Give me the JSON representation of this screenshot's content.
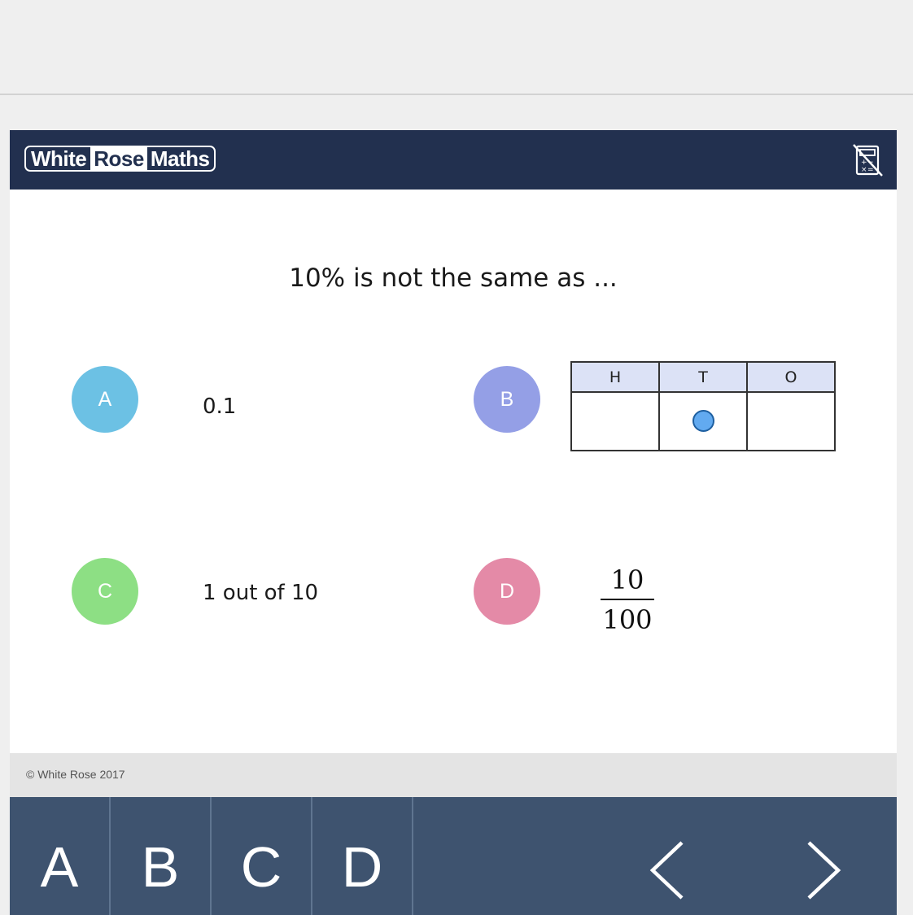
{
  "header": {
    "logo": {
      "word1": "White",
      "word2": "Rose",
      "word3": "Maths"
    },
    "calculator_icon": "calculator-disabled-icon"
  },
  "question": {
    "text": "10% is not the same as ..."
  },
  "options": {
    "a": {
      "letter": "A",
      "text": "0.1",
      "color": "#6cc1e4"
    },
    "b": {
      "letter": "B",
      "color": "#949fe6",
      "place_value_table": {
        "headers": [
          "H",
          "T",
          "O"
        ],
        "counter_column": "T",
        "counter_color": "#62aaf0"
      }
    },
    "c": {
      "letter": "C",
      "text": "1 out of 10",
      "color": "#8ddf84"
    },
    "d": {
      "letter": "D",
      "color": "#e48aa7",
      "fraction": {
        "numerator": "10",
        "denominator": "100"
      }
    }
  },
  "footer": {
    "copyright": "© White Rose 2017"
  },
  "nav": {
    "answers": [
      "A",
      "B",
      "C",
      "D"
    ],
    "prev_icon": "chevron-left-icon",
    "next_icon": "chevron-right-icon"
  },
  "colors": {
    "header_bg": "#22304f",
    "nav_bg": "#3e536f"
  }
}
